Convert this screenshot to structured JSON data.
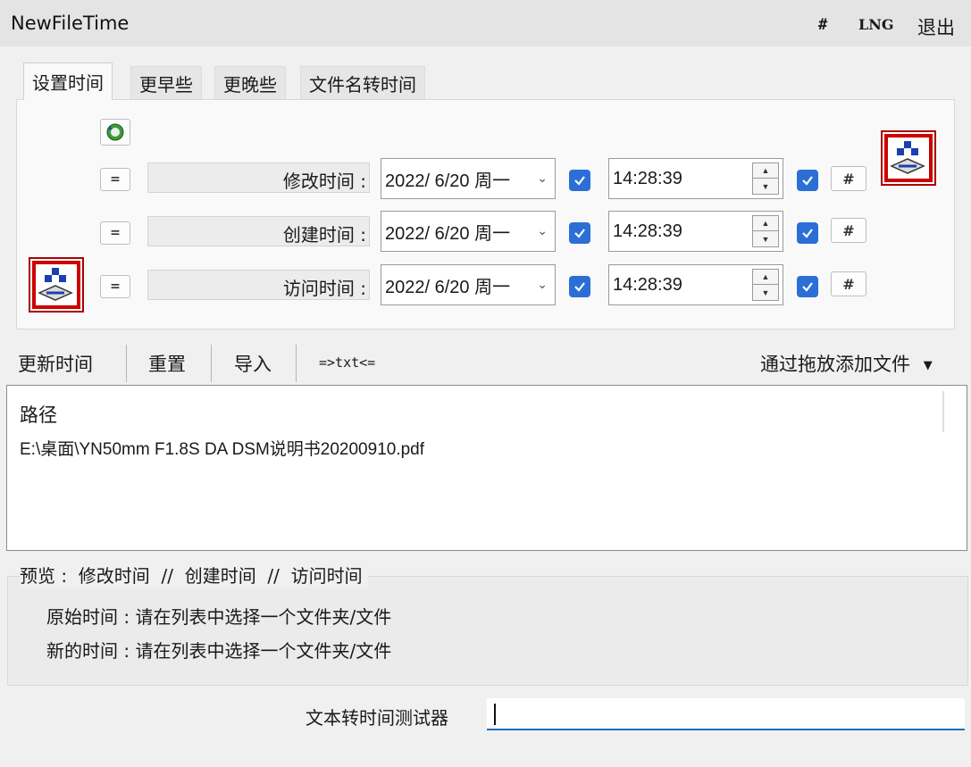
{
  "window": {
    "title": "NewFileTime",
    "hash_label": "#",
    "lng_label": "LNG",
    "exit_label": "退出"
  },
  "tabs": [
    {
      "label": "设置时间",
      "active": true
    },
    {
      "label": "更早些",
      "active": false
    },
    {
      "label": "更晚些",
      "active": false
    },
    {
      "label": "文件名转时间",
      "active": false
    }
  ],
  "time_rows": [
    {
      "eq_label": "=",
      "label": "修改时间 :",
      "date": "2022/ 6/20 周一",
      "date_checked": true,
      "time": "14:28:39",
      "time_checked": true,
      "hash_label": "#"
    },
    {
      "eq_label": "=",
      "label": "创建时间 :",
      "date": "2022/ 6/20 周一",
      "date_checked": true,
      "time": "14:28:39",
      "time_checked": true,
      "hash_label": "#"
    },
    {
      "eq_label": "=",
      "label": "访问时间 :",
      "date": "2022/ 6/20 周一",
      "date_checked": true,
      "time": "14:28:39",
      "time_checked": true,
      "hash_label": "#"
    }
  ],
  "toolbar": {
    "update": "更新时间",
    "reset": "重置",
    "import": "导入",
    "txt": "=>txt<=",
    "drag_add": "通过拖放添加文件"
  },
  "file_list": {
    "header": "路径",
    "rows": [
      "E:\\桌面\\YN50mm F1.8S DA DSM说明书20200910.pdf"
    ]
  },
  "preview": {
    "label": "预览 :  修改时间  //  创建时间  //  访问时间",
    "original": "原始时间 : 请在列表中选择一个文件夹/文件",
    "new": "新的时间 : 请在列表中选择一个文件夹/文件"
  },
  "tester": {
    "label": "文本转时间测试器",
    "value": ""
  },
  "colors": {
    "checkbox": "#2b6fd6",
    "input_underline": "#1f6fbf"
  }
}
